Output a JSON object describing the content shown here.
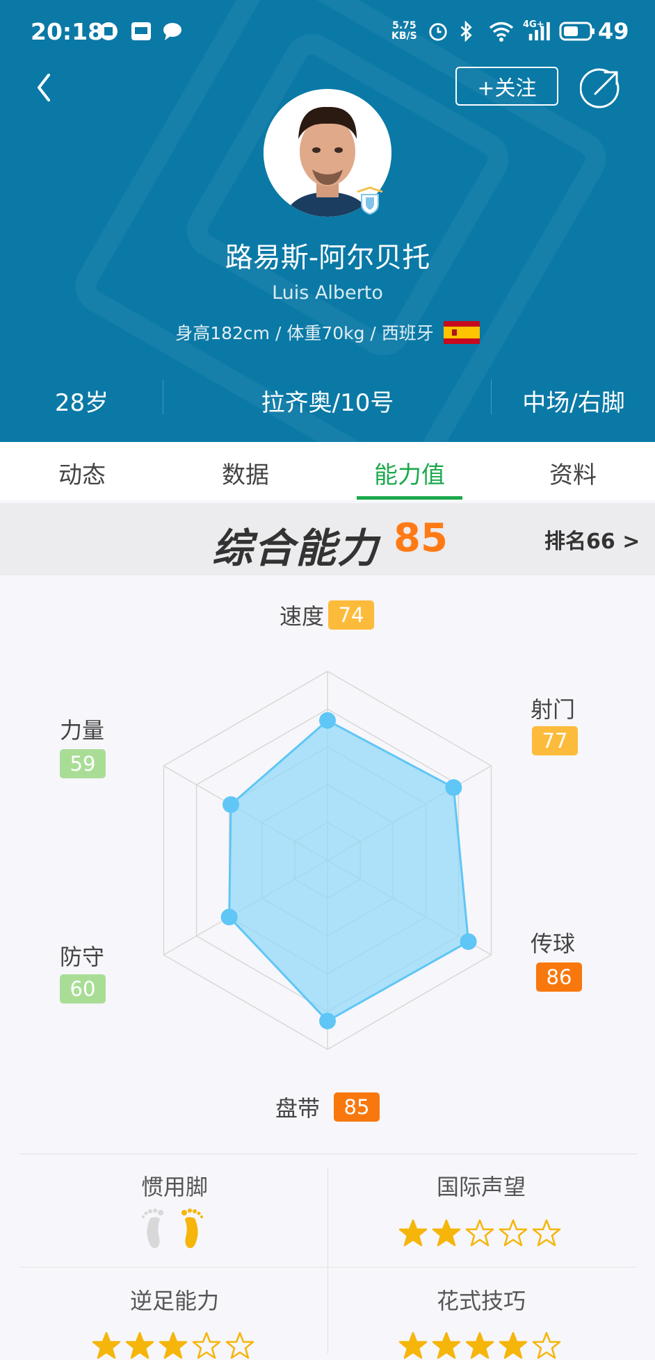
{
  "status_bar": {
    "time": "20:18",
    "speed_value": "5.75",
    "speed_unit": "KB/S",
    "network": "4G+",
    "battery": "49"
  },
  "header": {
    "follow_label": "+关注",
    "name_cn": "路易斯-阿尔贝托",
    "name_en": "Luis Alberto",
    "info_text": "身高182cm / 体重70kg / 西班牙",
    "age": "28岁",
    "club_number": "拉齐奥/10号",
    "position_foot": "中场/右脚",
    "bg_color": "#0a79a6"
  },
  "tabs": [
    {
      "label": "动态",
      "active": false
    },
    {
      "label": "数据",
      "active": false
    },
    {
      "label": "能力值",
      "active": true
    },
    {
      "label": "资料",
      "active": false
    }
  ],
  "overall": {
    "title": "综合能力",
    "score": "85",
    "rank_label": "排名66 >"
  },
  "chart_data": {
    "type": "radar",
    "axes": [
      "速度",
      "射门",
      "传球",
      "盘带",
      "防守",
      "力量"
    ],
    "values": [
      74,
      77,
      86,
      85,
      60,
      59
    ],
    "value_labels": [
      "74",
      "77",
      "86",
      "85",
      "60",
      "59"
    ],
    "value_colors": [
      "#fdbb3b",
      "#fdbb3b",
      "#f8780e",
      "#f8780e",
      "#a9dd96",
      "#a9dd96"
    ],
    "range": [
      0,
      100
    ],
    "fill_color": "#8fd8f8",
    "point_color": "#5fc6f5"
  },
  "attributes": {
    "preferred_foot": {
      "label": "惯用脚",
      "value": "右脚"
    },
    "intl_reputation": {
      "label": "国际声望",
      "stars": 2,
      "max": 5
    },
    "weak_foot": {
      "label": "逆足能力",
      "stars": 3,
      "max": 5
    },
    "skill_moves": {
      "label": "花式技巧",
      "stars": 4,
      "max": 5
    }
  },
  "colors": {
    "accent_green": "#1ca94c",
    "score_orange": "#ff7a14",
    "star_gold": "#f5b50a"
  }
}
